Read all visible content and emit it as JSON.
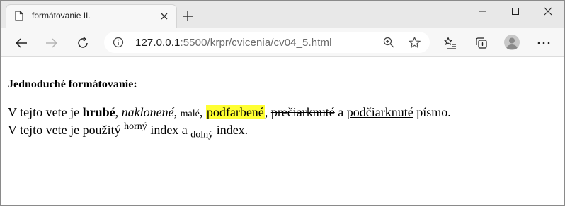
{
  "browser": {
    "tab_title": "formátovanie II.",
    "url_host": "127.0.0.1",
    "url_rest": ":5500/krpr/cvicenia/cv04_5.html"
  },
  "page": {
    "heading": "Jednoduché formátovanie:",
    "line1": {
      "p1": "V tejto vete je ",
      "bold": "hrubé",
      "s1": ", ",
      "italic": "naklonené",
      "s2": ", ",
      "small": "malé",
      "s3": ", ",
      "highlighted": "podfarbené",
      "s4": ", ",
      "strike": "prečiarknuté",
      "s5": " a ",
      "underline": "podčiarknuté",
      "s6": " písmo."
    },
    "line2": {
      "p1": "V tejto vete je použitý ",
      "sup": "horný",
      "p2": " index a ",
      "sub": "dolný",
      "p3": " index."
    }
  },
  "colors": {
    "highlight": "#ffff33",
    "tabstrip": "#e8e8e8",
    "toolbar": "#f7f7f7"
  }
}
